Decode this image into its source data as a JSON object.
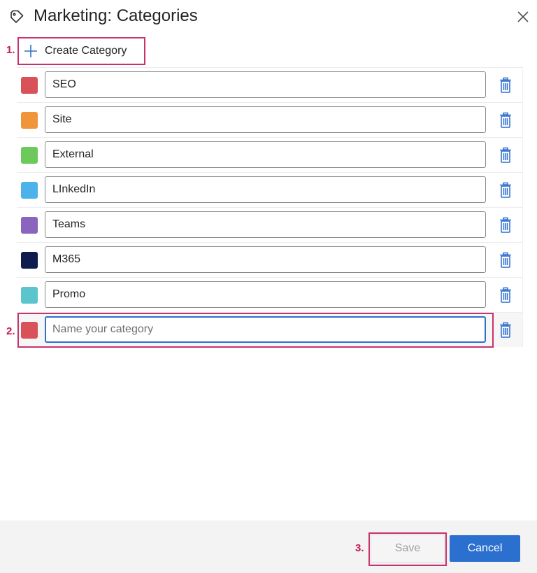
{
  "dialog": {
    "title": "Marketing: Categories",
    "icon": "tag-icon",
    "close_icon": "close-icon"
  },
  "annotations": [
    "1.",
    "2.",
    "3."
  ],
  "create_button": {
    "label": "Create Category",
    "icon": "plus-icon"
  },
  "categories": [
    {
      "name": "SEO",
      "color": "#d9525a"
    },
    {
      "name": "Site",
      "color": "#f0953a"
    },
    {
      "name": "External",
      "color": "#6cc95a"
    },
    {
      "name": "LInkedIn",
      "color": "#4cb3ea"
    },
    {
      "name": "Teams",
      "color": "#8a65bd"
    },
    {
      "name": "M365",
      "color": "#0e1c4e"
    },
    {
      "name": "Promo",
      "color": "#5bc4cc"
    }
  ],
  "new_category": {
    "value": "",
    "placeholder": "Name your category",
    "color": "#d9525a"
  },
  "row_action_icon": "trash-icon",
  "footer": {
    "save_label": "Save",
    "cancel_label": "Cancel"
  },
  "colors": {
    "accent": "#2b6fcf",
    "highlight": "#c8326e"
  }
}
